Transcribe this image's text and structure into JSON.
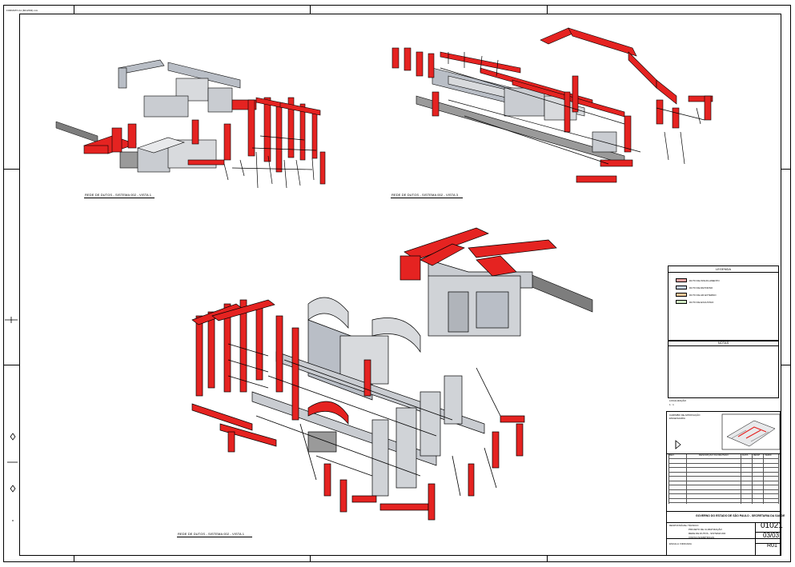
{
  "sheet": {
    "corner_note": "FORMATO A1 (841x594) mm",
    "colors": {
      "duct_red": "#e52321",
      "duct_gray": "#b9bec6",
      "outline": "#000000"
    }
  },
  "views": {
    "view1_label": "REDE DE DUTOS - SISTEMA 002 - VISTA 1",
    "view2_label": "REDE DE DUTOS - SISTEMA 002 - VISTA 3",
    "view3_label": "REDE DE DUTOS - SISTEMA 002 - VISTA 1"
  },
  "legend": {
    "title": "LEGENDA",
    "items": [
      {
        "text": "DUTO DE INSUFLAMENTO",
        "color": "#f4a6a6"
      },
      {
        "text": "DUTO DE RETORNO",
        "color": "#c6d4ee"
      },
      {
        "text": "DUTO DE AR EXTERNO",
        "color": "#f7c99a"
      },
      {
        "text": "DUTO DE EXAUSTAO",
        "color": "#cfe8c2"
      }
    ]
  },
  "notes": {
    "title": "NOTAS",
    "bottom_text": "LOCALIZAÇÃO",
    "bottom_sub": "1 : 1"
  },
  "titleblock": {
    "header_text_1": "CARIMBO DE APROVAÇÃO",
    "header_text_2": "ENGENHARIA",
    "org": "GOVERNO DO ESTADO DE SÃO PAULO - SECRETARIA DA SAÚDE",
    "rev_header": [
      "REV.",
      "DESCRIÇÃO DA REVISÃO",
      "DATA",
      "RESP.",
      "VERIF."
    ],
    "drawing_number": "01021",
    "sheet_number": "03/03",
    "revision": "R01",
    "small_1": "RESPONSÁVEL TÉCNICO",
    "small_2": "PROJETO DE CLIMATIZAÇÃO",
    "small_3": "REDE DE DUTOS - SISTEMA 002",
    "small_4": "VISTAS ISOMÉTRICAS",
    "small_5": "ESCALA: INDICADA"
  }
}
